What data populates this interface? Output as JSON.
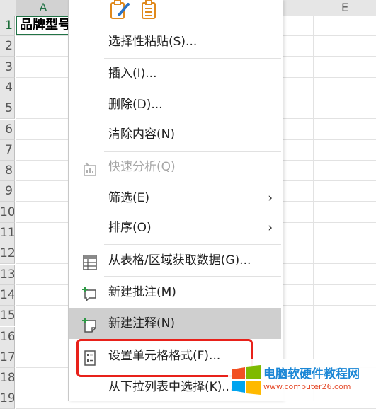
{
  "sheet": {
    "columns": [
      "A",
      "E"
    ],
    "rows": [
      "1",
      "2",
      "3",
      "4",
      "5",
      "6",
      "7",
      "8",
      "9",
      "10",
      "11",
      "12",
      "13",
      "14",
      "15",
      "16",
      "17",
      "18",
      "19"
    ],
    "cell_a1": "品牌型号",
    "accent_color": "#217346"
  },
  "menu": {
    "top_icons": [
      "paste-brush-icon",
      "paste-values-icon"
    ],
    "items": [
      {
        "label": "选择性粘贴(S)...",
        "icon": "",
        "enabled": true
      },
      {
        "label": "插入(I)...",
        "icon": "",
        "enabled": true
      },
      {
        "label": "删除(D)...",
        "icon": "",
        "enabled": true
      },
      {
        "label": "清除内容(N)",
        "icon": "",
        "enabled": true
      },
      {
        "label": "快速分析(Q)",
        "icon": "quick-analysis-icon",
        "enabled": false
      },
      {
        "label": "筛选(E)",
        "icon": "",
        "enabled": true,
        "submenu": true
      },
      {
        "label": "排序(O)",
        "icon": "",
        "enabled": true,
        "submenu": true
      },
      {
        "label": "从表格/区域获取数据(G)...",
        "icon": "table-icon",
        "enabled": true
      },
      {
        "label": "新建批注(M)",
        "icon": "new-comment-icon",
        "enabled": true
      },
      {
        "label": "新建注释(N)",
        "icon": "new-note-icon",
        "enabled": true,
        "highlighted": true
      },
      {
        "label": "设置单元格格式(F)...",
        "icon": "format-cells-icon",
        "enabled": true,
        "outlined": true
      },
      {
        "label": "从下拉列表中选择(K)...",
        "icon": "",
        "enabled": true
      }
    ],
    "submenu_arrow": "›",
    "highlight_outline_color": "#e8211a"
  },
  "watermark": {
    "title": "电脑软硬件教程网",
    "url": "www.computer26.com"
  }
}
